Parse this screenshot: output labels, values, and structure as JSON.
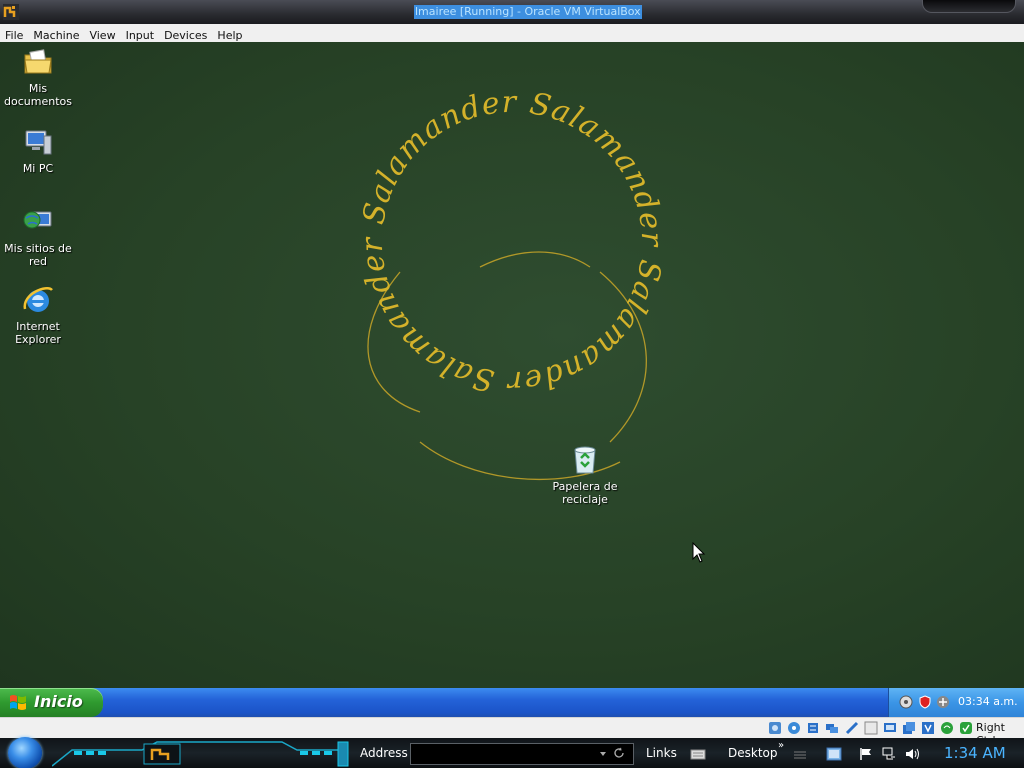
{
  "window": {
    "title": "lmairee [Running] - Oracle VM VirtualBox"
  },
  "menubar": {
    "items": [
      "File",
      "Machine",
      "View",
      "Input",
      "Devices",
      "Help"
    ]
  },
  "desktop": {
    "wallpaper_text": "Salamander",
    "icons": [
      {
        "label": "Mis documentos",
        "icon": "folder-documents-icon"
      },
      {
        "label": "Mi PC",
        "icon": "computer-icon"
      },
      {
        "label": "Mis sitios de red",
        "icon": "network-places-icon"
      },
      {
        "label": "Internet Explorer",
        "icon": "internet-explorer-icon"
      },
      {
        "label": "Papelera de reciclaje",
        "icon": "recycle-bin-icon"
      }
    ]
  },
  "guest_taskbar": {
    "start_label": "Inicio",
    "clock": "03:34 a.m."
  },
  "status_strip": {
    "host_key": "Right Ctrl"
  },
  "host_taskbar": {
    "address_label": "Address",
    "links_label": "Links",
    "desktop_label": "Desktop",
    "clock": "1:34 AM"
  },
  "colors": {
    "desktop_green": "#274226",
    "wallpaper_text": "#d4b22a",
    "start_green": "#2f9a2f",
    "taskbar_blue": "#2462d8",
    "host_clock": "#4ab4ff"
  }
}
